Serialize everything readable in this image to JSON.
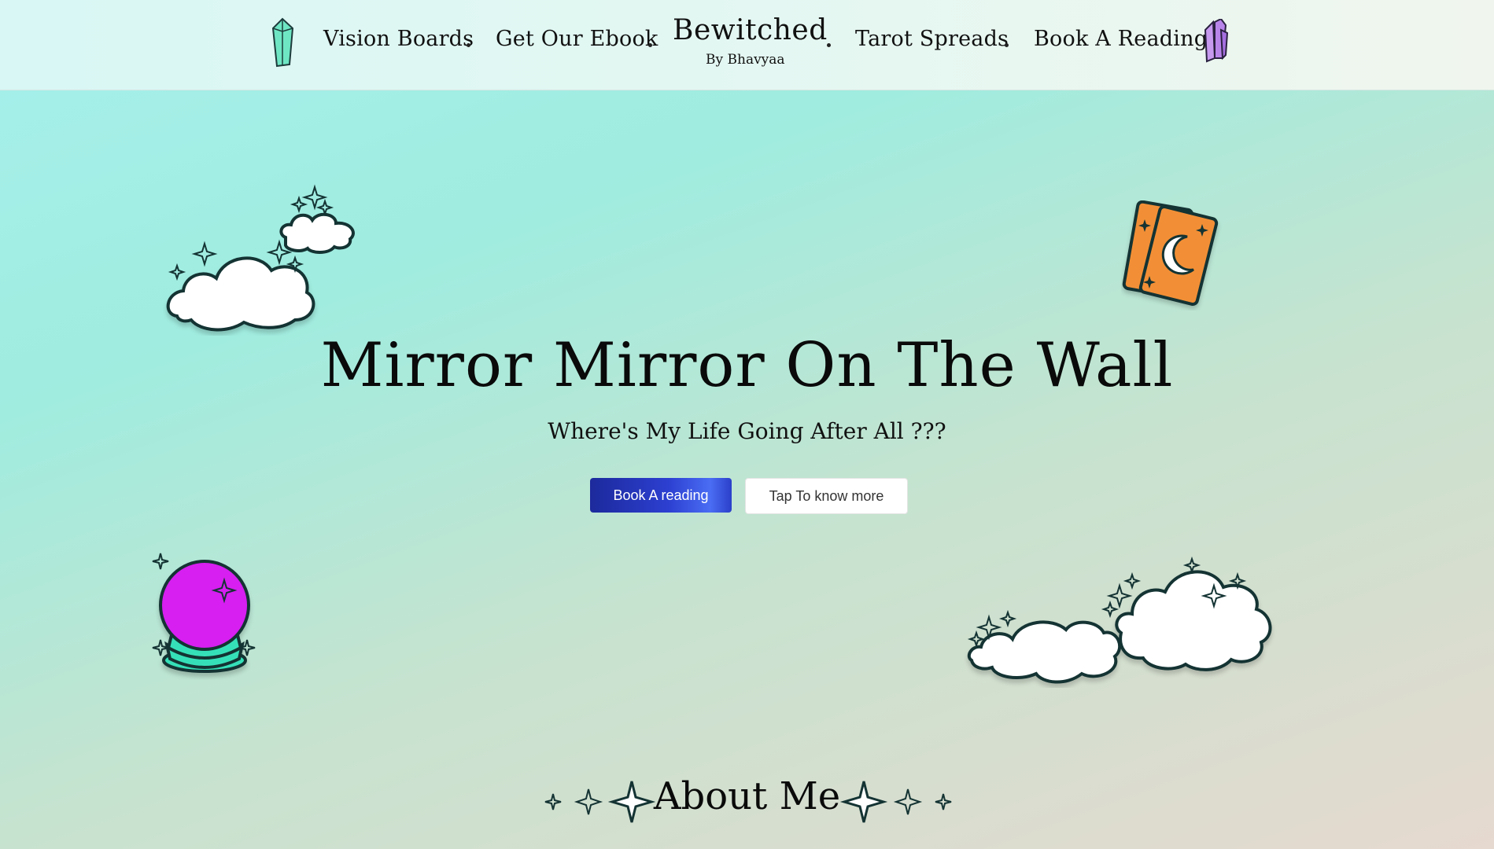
{
  "nav": {
    "links": [
      "Vision Boards",
      "Get Our Ebook",
      "Tarot Spreads",
      "Book A Reading"
    ],
    "brand": {
      "title": "Bewitched",
      "subtitle": "By Bhavyaa"
    },
    "left_icon": "crystal-icon",
    "right_icon": "crystal-cluster-icon"
  },
  "hero": {
    "title": "Mirror Mirror On The Wall",
    "subtitle": "Where's My Life Going After All ???",
    "primary_button": "Book A reading",
    "secondary_button": "Tap To know more"
  },
  "decorations": [
    "cloud-icon",
    "tarot-cards-icon",
    "crystal-ball-icon",
    "cloud-icon"
  ],
  "about": {
    "heading": "About Me"
  },
  "colors": {
    "primary_button": "#2c3fd0",
    "crystal_ball": "#d61ff0",
    "tarot_card": "#f28f36",
    "accent_teal": "#35e0b8"
  }
}
